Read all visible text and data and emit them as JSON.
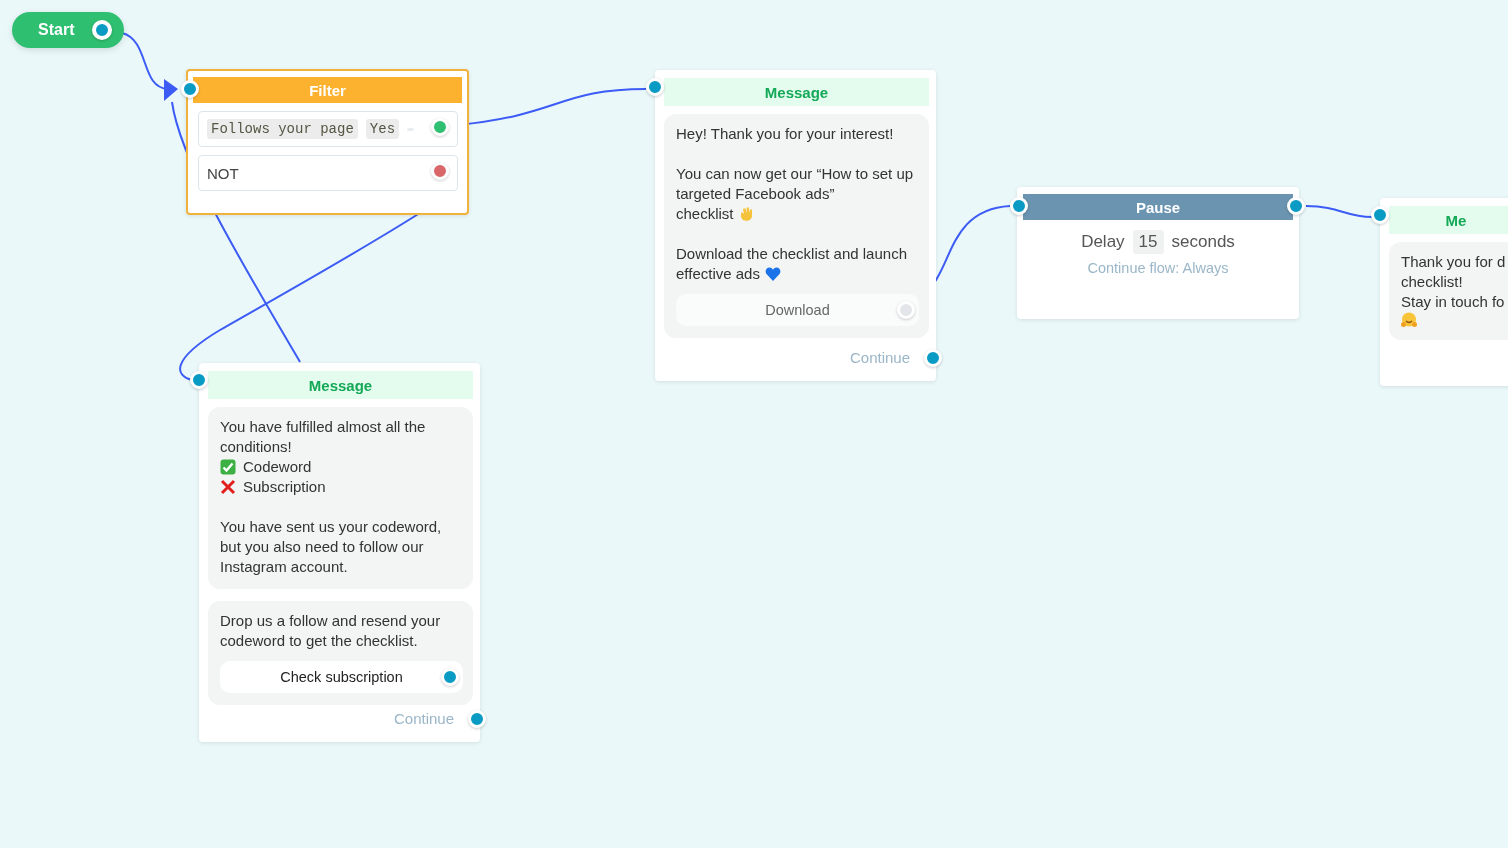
{
  "start": {
    "label": "Start"
  },
  "filter": {
    "title": "Filter",
    "conditions": [
      {
        "kind": "tags",
        "tags": [
          "Follows your page",
          "Yes"
        ],
        "color": "#2fbf71"
      },
      {
        "kind": "text",
        "text": "NOT",
        "color": "#d9676a"
      }
    ]
  },
  "messages": [
    {
      "title": "Message",
      "blocks": [
        {
          "paragraphs": [
            [
              {
                "kind": "text",
                "text": "You have fulfilled almost all the conditions!"
              },
              {
                "kind": "check",
                "text": "Codeword"
              },
              {
                "kind": "cross",
                "text": "Subscription"
              }
            ],
            [
              {
                "kind": "text",
                "text": "You have sent us your codeword, but you also need to follow our Instagram account."
              }
            ]
          ]
        },
        {
          "paragraphs": [
            [
              {
                "kind": "text",
                "text": "Drop us a follow and resend your codeword to get the checklist."
              }
            ]
          ],
          "button": {
            "label": "Check subscription",
            "connected": true
          }
        }
      ],
      "continue": "Continue"
    },
    {
      "title": "Message",
      "blocks": [
        {
          "paragraphs": [
            [
              {
                "kind": "text",
                "text": "Hey! Thank you for your interest!"
              }
            ],
            [
              {
                "kind": "text",
                "text": "You can now get our “How to set up targeted Facebook ads”"
              },
              {
                "kind": "wave",
                "text": "checklist"
              }
            ],
            [
              {
                "kind": "text",
                "text": "Download the checklist and launch"
              },
              {
                "kind": "heart",
                "text": "effective ads"
              }
            ]
          ],
          "button": {
            "label": "Download",
            "connected": false
          }
        }
      ],
      "continue": "Continue"
    },
    {
      "title": "Me",
      "blocks": [
        {
          "paragraphs": [
            [
              {
                "kind": "text",
                "text": "Thank you for d"
              },
              {
                "kind": "text",
                "text": "checklist!"
              },
              {
                "kind": "text",
                "text": "Stay in touch fo"
              },
              {
                "kind": "hug"
              }
            ]
          ]
        }
      ]
    }
  ],
  "pause": {
    "title": "Pause",
    "delay_label": "Delay",
    "delay_value": "15",
    "unit": "seconds",
    "note": "Continue flow: Always"
  }
}
